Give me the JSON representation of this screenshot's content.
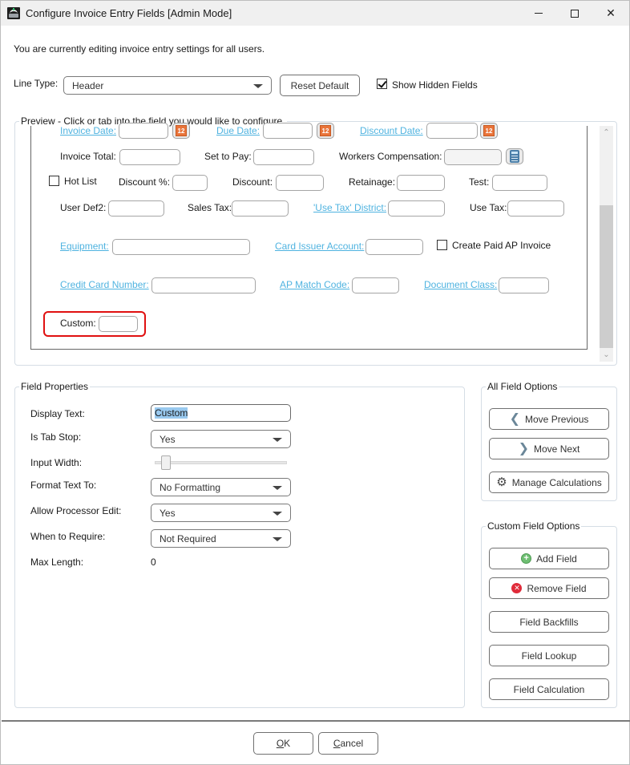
{
  "window": {
    "title": "Configure Invoice Entry Fields [Admin Mode]",
    "app_icon": "spc-app-icon",
    "controls": {
      "minimize": "minimize-icon",
      "maximize": "maximize-icon",
      "close": "close-icon"
    }
  },
  "info_text": "You are currently editing invoice entry settings for all users.",
  "toolbar": {
    "line_type_label": "Line Type:",
    "line_type_value": "Header",
    "reset_default_label": "Reset Default",
    "show_hidden_fields_label": "Show Hidden Fields",
    "show_hidden_fields_checked": true
  },
  "preview": {
    "title": "Preview - Click or tab into the field you would like to configure.",
    "fields": {
      "invoice_date": "Invoice Date:",
      "due_date": "Due Date:",
      "discount_date": "Discount Date:",
      "invoice_total": "Invoice Total:",
      "set_to_pay": "Set to Pay:",
      "workers_compensation": "Workers Compensation:",
      "hot_list": "Hot List",
      "discount_pct": "Discount %:",
      "discount": "Discount:",
      "retainage": "Retainage:",
      "test": "Test:",
      "user_def2": "User Def2:",
      "sales_tax": "Sales Tax:",
      "use_tax_district": "'Use Tax' District:",
      "use_tax": "Use Tax:",
      "equipment": "Equipment:",
      "card_issuer_account": "Card Issuer Account:",
      "create_paid_ap_invoice": "Create Paid AP Invoice",
      "credit_card_number": "Credit Card Number:",
      "ap_match_code": "AP Match Code:",
      "document_class": "Document Class:",
      "custom": "Custom:"
    },
    "calendar_icon_text": "12",
    "hot_list_checked": false,
    "create_paid_ap_invoice_checked": false
  },
  "field_properties": {
    "title": "Field Properties",
    "display_text_label": "Display Text:",
    "display_text_value": "Custom",
    "is_tab_stop_label": "Is Tab Stop:",
    "is_tab_stop_value": "Yes",
    "input_width_label": "Input Width:",
    "input_width_fraction": 0.05,
    "format_text_to_label": "Format Text To:",
    "format_text_to_value": "No Formatting",
    "allow_processor_edit_label": "Allow Processor Edit:",
    "allow_processor_edit_value": "Yes",
    "when_to_require_label": "When to Require:",
    "when_to_require_value": "Not Required",
    "max_length_label": "Max Length:",
    "max_length_value": "0"
  },
  "all_field_options": {
    "title": "All Field Options",
    "move_previous": "Move Previous",
    "move_next": "Move Next",
    "manage_calculations": "Manage Calculations"
  },
  "custom_field_options": {
    "title": "Custom Field Options",
    "add_field": "Add Field",
    "remove_field": "Remove Field",
    "field_backfills": "Field Backfills",
    "field_lookup": "Field Lookup",
    "field_calculation": "Field Calculation"
  },
  "footer": {
    "ok_accel": "O",
    "ok_rest": "K",
    "cancel_accel": "C",
    "cancel_rest": "ancel"
  },
  "colors": {
    "link": "#4fb3e0",
    "highlight_border": "#e01010",
    "selection": "#99c9ef",
    "calendar": "#e9743a"
  }
}
